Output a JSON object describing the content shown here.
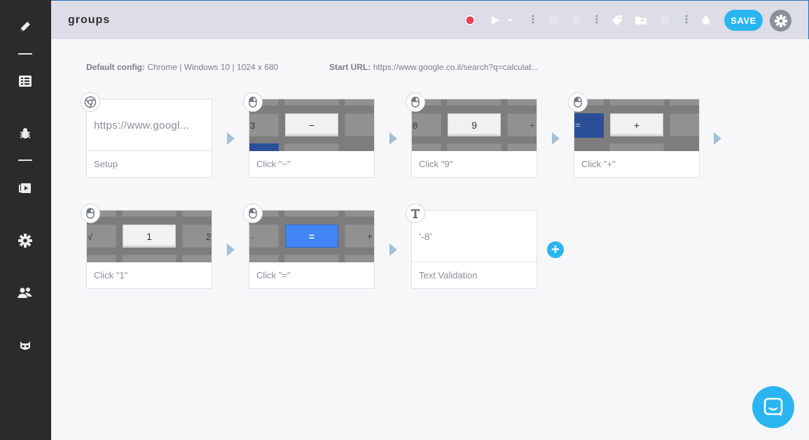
{
  "sidebar": {
    "items": [
      {
        "icon": "pencil-icon"
      },
      {
        "icon": "list-icon"
      },
      {
        "icon": "bug-icon"
      },
      {
        "icon": "play-window-icon"
      },
      {
        "icon": "gear-icon"
      },
      {
        "icon": "users-icon"
      },
      {
        "icon": "mask-icon"
      }
    ]
  },
  "topbar": {
    "title": "groups",
    "save_label": "SAVE",
    "record_color": "#e8445a",
    "accent": "#2ab5f1"
  },
  "config": {
    "default_label": "Default config:",
    "default_value": "Chrome | Windows 10 | 1024 x 680",
    "start_url_label": "Start URL:",
    "start_url_value": "https://www.google.co.il/search?q=calculat..."
  },
  "steps": [
    {
      "caption": "Setup",
      "text": "https://www.googl...",
      "type": "setup"
    },
    {
      "caption": "Click \"−\"",
      "key": "−",
      "type": "click"
    },
    {
      "caption": "Click \"9\"",
      "key": "9",
      "type": "click"
    },
    {
      "caption": "Click \"+\"",
      "key": "+",
      "type": "click"
    },
    {
      "caption": "Click \"1\"",
      "key": "1",
      "type": "click"
    },
    {
      "caption": "Click \"=\"",
      "key": "=",
      "type": "click"
    },
    {
      "caption": "Text Validation",
      "text": "'-8'",
      "type": "validation"
    }
  ],
  "thumb_text": {
    "s2_left": "3",
    "s3_left": "8",
    "s3_right": "÷",
    "s4_left": "=",
    "s5_left": "√",
    "s5_right": "2",
    "s6_left": ".",
    "s6_right": "+"
  },
  "add_step_label": "+"
}
